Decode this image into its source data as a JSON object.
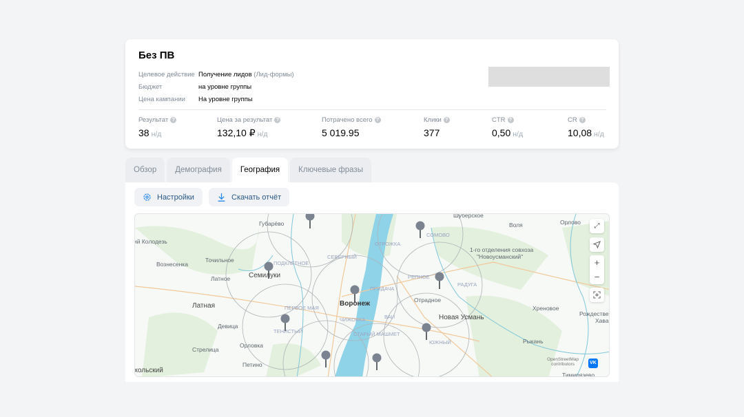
{
  "campaign": {
    "title": "Без ПВ",
    "props": [
      {
        "label": "Целевое действие",
        "value": "Получение лидов",
        "extra": "(Лид-формы)"
      },
      {
        "label": "Бюджет",
        "value": "на уровне группы"
      },
      {
        "label": "Цена кампании",
        "value": "На уровне группы"
      }
    ],
    "stats": [
      {
        "label": "Результат",
        "value": "38",
        "nd": "н/д"
      },
      {
        "label": "Цена за результат",
        "value": "132,10 ₽",
        "nd": "н/д"
      },
      {
        "label": "Потрачено всего",
        "value": "5 019.95"
      },
      {
        "label": "Клики",
        "value": "377"
      },
      {
        "label": "CTR",
        "value": "0,50",
        "nd": "н/д"
      },
      {
        "label": "CR",
        "value": "10,08",
        "nd": "н/д"
      }
    ]
  },
  "tabs": [
    {
      "label": "Обзор"
    },
    {
      "label": "Демография"
    },
    {
      "label": "География",
      "active": true
    },
    {
      "label": "Ключевые фразы"
    }
  ],
  "toolbar": {
    "settings_label": "Настройки",
    "download_label": "Скачать отчёт"
  },
  "map": {
    "labels": [
      "Губарёво",
      "Шуберское",
      "Воля",
      "Орлово",
      "ий Колодезь",
      "Вознесенка",
      "Точильное",
      "Подклетное",
      "Северный",
      "Семилуки",
      "Латное",
      "Отрожка",
      "Сомово",
      "1-го отделения совхоза",
      "\"Новоусманский\"",
      "Репное",
      "Радуга",
      "Придача",
      "Воронеж",
      "Латная",
      "Первое Мая",
      "Отрадное",
      "Хреновое",
      "Девица",
      "Чижовка",
      "Ваи",
      "Новая Усмань",
      "Рождественская",
      "Хава",
      "Тенистый",
      "Старый Машмет",
      "Южный",
      "Орловка",
      "Рыкань",
      "Стрелица",
      "Петино",
      "хольский",
      "Тимирязево"
    ],
    "attribution": [
      "OpenStreetMap",
      "contributors"
    ],
    "vk_logo": "VK",
    "controls": [
      "fullscreen-icon",
      "location-arrow-icon",
      "zoom-in-icon",
      "zoom-out-icon",
      "geo-focus-icon"
    ],
    "pin_color": "#7a838f",
    "water_color": "#8fd3e8"
  }
}
